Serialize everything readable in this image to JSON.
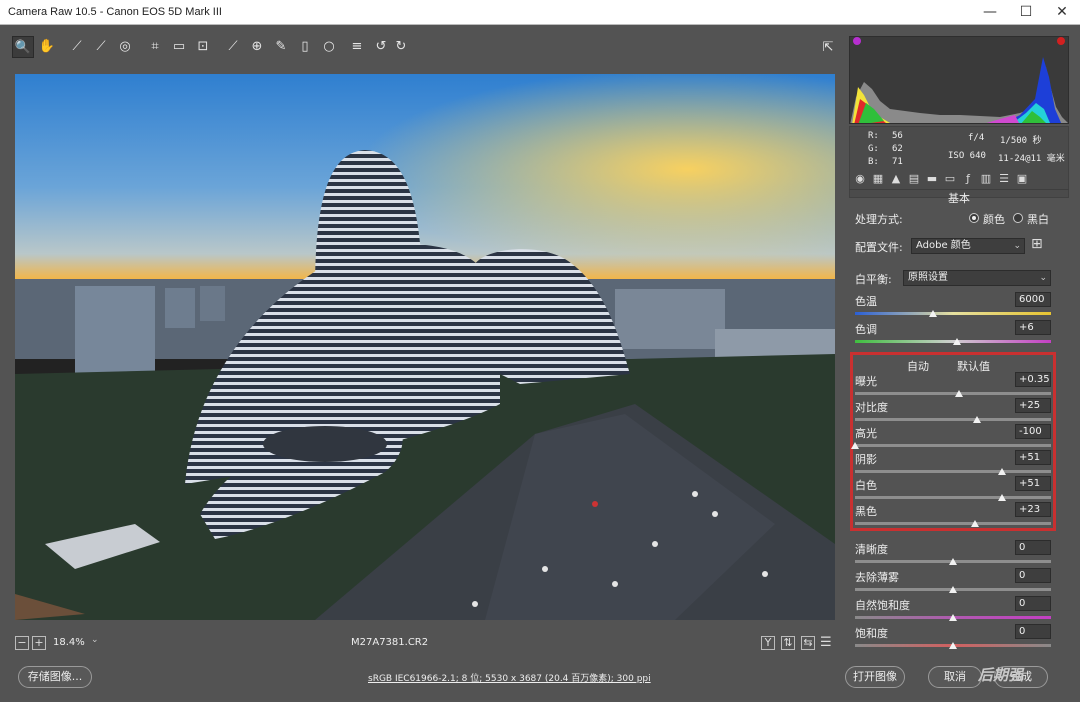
{
  "window": {
    "title": "Camera Raw 10.5 -  Canon EOS 5D Mark III",
    "minimize": "—",
    "maximize": "☐",
    "close": "✕"
  },
  "toolbar": {
    "tools": [
      "zoom-tool",
      "hand-tool",
      "white-balance-tool",
      "color-sampler-tool",
      "target-adjustment-tool",
      "crop-tool",
      "straighten-tool",
      "transform-tool",
      "spot-removal-tool",
      "red-eye-tool",
      "adjustment-brush-tool",
      "graduated-filter-tool",
      "radial-filter-tool",
      "preferences",
      "rotate-left",
      "rotate-right"
    ],
    "glyphs": [
      "🔍",
      "✋",
      "⟋",
      "⟋",
      "◎",
      "⌗",
      "▭",
      "⊡",
      "⟋",
      "⊕",
      "✎",
      "▯",
      "○",
      "≡",
      "↺",
      "↻"
    ],
    "fullscreen": "⇱"
  },
  "statusbar": {
    "zoom_out": "−",
    "zoom_in": "+",
    "zoom_level": "18.4%",
    "filename": "M27A7381.CR2"
  },
  "bottombar": {
    "save": "存储图像...",
    "workflow": "sRGB IEC61966-2.1; 8 位; 5530 x 3687 (20.4 百万像素); 300 ppi",
    "open": "打开图像",
    "cancel": "取消",
    "done": "完成",
    "watermark": "后期强"
  },
  "info": {
    "r_label": "R:",
    "r": "56",
    "g_label": "G:",
    "g": "62",
    "b_label": "B:",
    "b": "71",
    "aperture": "f/4",
    "shutter": "1/500 秒",
    "iso": "ISO 640",
    "lens": "11-24@11 毫米"
  },
  "panel": {
    "section": "基本",
    "treatment_label": "处理方式:",
    "treatment_color": "颜色",
    "treatment_bw": "黑白",
    "profile_label": "配置文件:",
    "profile_value": "Adobe 颜色",
    "wb_label": "白平衡:",
    "wb_value": "原照设置",
    "auto": "自动",
    "default": "默认值",
    "sliders": [
      {
        "label": "色温",
        "value": "6000",
        "pos": 0.4
      },
      {
        "label": "色调",
        "value": "+6",
        "pos": 0.52
      },
      {
        "label": "曝光",
        "value": "+0.35",
        "pos": 0.53
      },
      {
        "label": "对比度",
        "value": "+25",
        "pos": 0.62
      },
      {
        "label": "高光",
        "value": "-100",
        "pos": 0.0
      },
      {
        "label": "阴影",
        "value": "+51",
        "pos": 0.75
      },
      {
        "label": "白色",
        "value": "+51",
        "pos": 0.75
      },
      {
        "label": "黑色",
        "value": "+23",
        "pos": 0.61
      },
      {
        "label": "清晰度",
        "value": "0",
        "pos": 0.5
      },
      {
        "label": "去除薄雾",
        "value": "0",
        "pos": 0.5
      },
      {
        "label": "自然饱和度",
        "value": "0",
        "pos": 0.5
      },
      {
        "label": "饱和度",
        "value": "0",
        "pos": 0.5
      }
    ]
  }
}
